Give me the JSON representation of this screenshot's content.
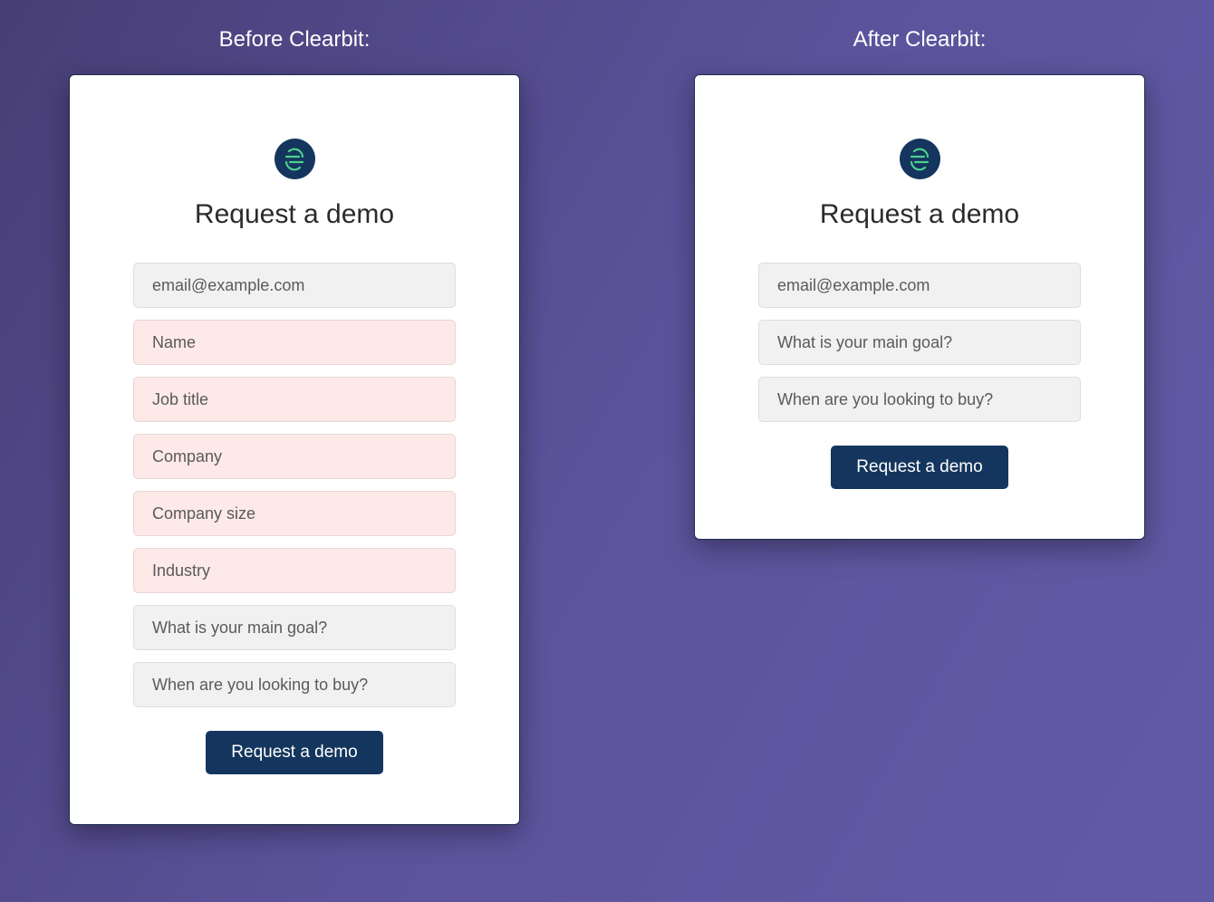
{
  "before": {
    "heading": "Before Clearbit:",
    "title": "Request a demo",
    "fields": [
      {
        "placeholder": "email@example.com",
        "variant": "gray"
      },
      {
        "placeholder": "Name",
        "variant": "pink"
      },
      {
        "placeholder": "Job title",
        "variant": "pink"
      },
      {
        "placeholder": "Company",
        "variant": "pink"
      },
      {
        "placeholder": "Company size",
        "variant": "pink"
      },
      {
        "placeholder": "Industry",
        "variant": "pink"
      },
      {
        "placeholder": "What is your main goal?",
        "variant": "gray"
      },
      {
        "placeholder": "When are you looking to buy?",
        "variant": "gray"
      }
    ],
    "submit_label": "Request a demo"
  },
  "after": {
    "heading": "After Clearbit:",
    "title": "Request a demo",
    "fields": [
      {
        "placeholder": "email@example.com",
        "variant": "gray"
      },
      {
        "placeholder": "What is your main goal?",
        "variant": "gray"
      },
      {
        "placeholder": "When are you looking to buy?",
        "variant": "gray"
      }
    ],
    "submit_label": "Request a demo"
  },
  "colors": {
    "background_start": "#483e76",
    "background_end": "#625aa5",
    "card_bg": "#ffffff",
    "button_bg": "#14365e",
    "field_gray": "#f1f1f1",
    "field_pink": "#fce9e8"
  }
}
